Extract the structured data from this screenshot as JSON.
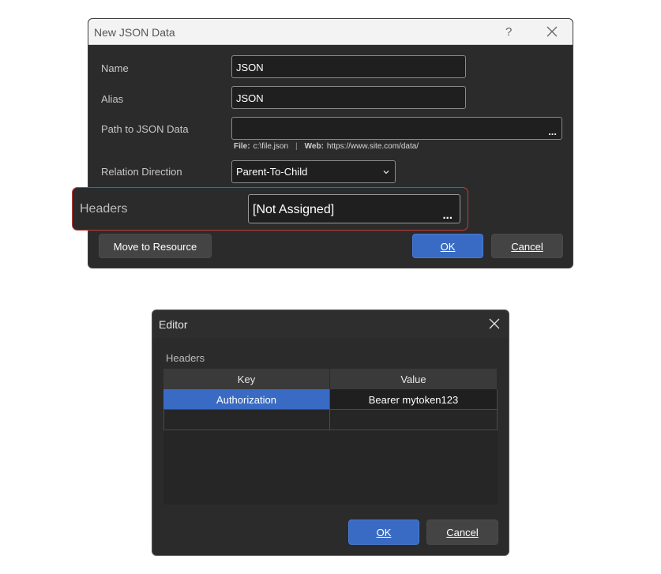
{
  "dialog1": {
    "title": "New JSON Data",
    "help_glyph": "?",
    "fields": {
      "name": {
        "label": "Name",
        "value": "JSON"
      },
      "alias": {
        "label": "Alias",
        "value": "JSON"
      },
      "path": {
        "label": "Path to JSON Data",
        "value": "",
        "browse": "...",
        "hint_file_label": "File:",
        "hint_file_value": "c:\\file.json",
        "hint_sep": "|",
        "hint_web_label": "Web:",
        "hint_web_value": "https://www.site.com/data/"
      },
      "relation": {
        "label": "Relation Direction",
        "value": "Parent-To-Child"
      },
      "headers": {
        "label": "Headers",
        "value": "[Not Assigned]",
        "browse": "..."
      }
    },
    "buttons": {
      "move": "Move to Resource",
      "ok": "OK",
      "cancel": "Cancel"
    }
  },
  "dialog2": {
    "title": "Editor",
    "caption": "Headers",
    "columns": [
      "Key",
      "Value"
    ],
    "rows": [
      {
        "key": "Authorization",
        "value": "Bearer mytoken123"
      },
      {
        "key": "",
        "value": ""
      }
    ],
    "buttons": {
      "ok": "OK",
      "cancel": "Cancel"
    }
  },
  "colors": {
    "accent": "#3a6bc4",
    "highlight": "#c23b3b",
    "background": "#2b2b2b"
  }
}
